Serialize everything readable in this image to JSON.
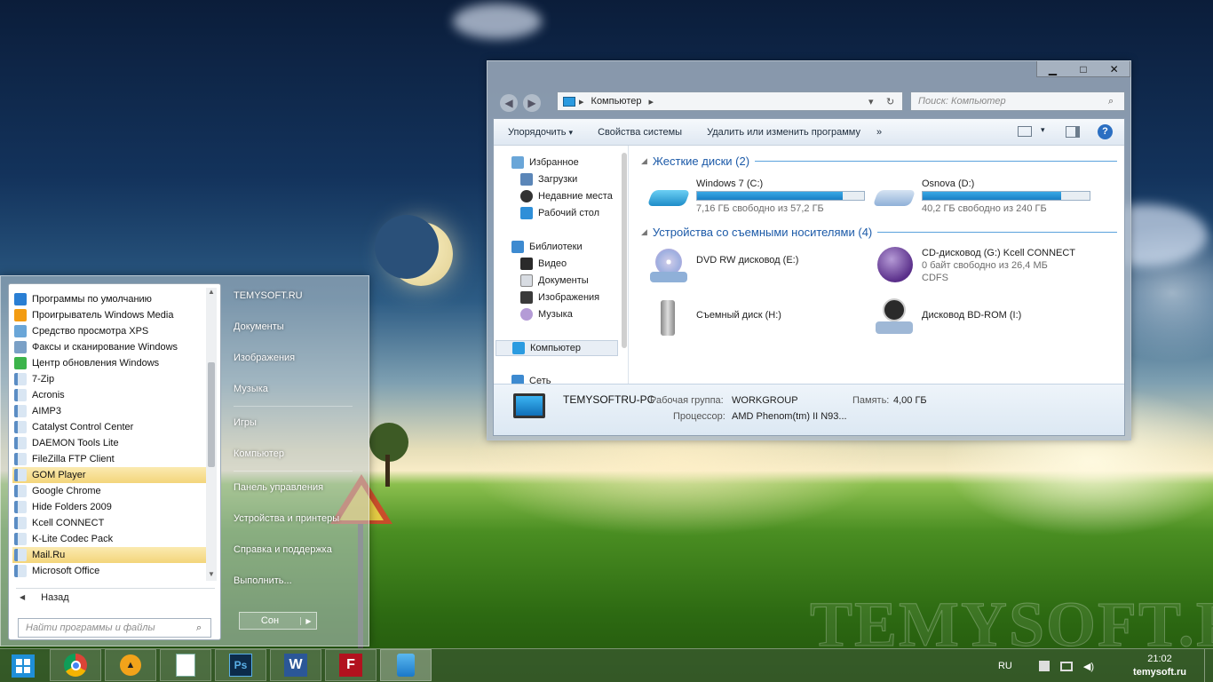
{
  "explorer": {
    "window_controls": {
      "minimize": "▁",
      "maximize": "□",
      "close": "✕"
    },
    "address": {
      "crumb": "Компьютер",
      "separator": "▸"
    },
    "search_placeholder": "Поиск: Компьютер",
    "toolbar": {
      "organize": "Упорядочить",
      "system_properties": "Свойства системы",
      "uninstall": "Удалить или изменить программу",
      "more": "»"
    },
    "nav": {
      "favorites": "Избранное",
      "downloads": "Загрузки",
      "recent": "Недавние места",
      "desktop": "Рабочий стол",
      "libraries": "Библиотеки",
      "video": "Видео",
      "documents": "Документы",
      "images": "Изображения",
      "music": "Музыка",
      "computer": "Компьютер",
      "network": "Сеть"
    },
    "groups": {
      "hard_drives": "Жесткие диски (2)",
      "removable": "Устройства со съемными носителями (4)"
    },
    "drives": [
      {
        "name": "Windows 7 (C:)",
        "free": "7,16 ГБ свободно из 57,2 ГБ",
        "used_fraction": 0.87
      },
      {
        "name": "Osnova (D:)",
        "free": "40,2 ГБ свободно из 240 ГБ",
        "used_fraction": 0.83
      }
    ],
    "removable": [
      {
        "name": "DVD RW дисковод (E:)"
      },
      {
        "name": "CD-дисковод (G:) Kcell CONNECT",
        "line2": "0 байт свободно из 26,4 МБ",
        "line3": "CDFS"
      },
      {
        "name": "Съемный диск (H:)"
      },
      {
        "name": "Дисковод BD-ROM (I:)"
      }
    ],
    "details": {
      "pc_name": "TEMYSOFTRU-PC",
      "workgroup_label": "Рабочая группа:",
      "workgroup": "WORKGROUP",
      "memory_label": "Память:",
      "memory": "4,00 ГБ",
      "cpu_label": "Процессор:",
      "cpu": "AMD Phenom(tm) II N93..."
    }
  },
  "start_menu": {
    "programs": [
      "Программы по умолчанию",
      "Проигрыватель Windows Media",
      "Средство просмотра XPS",
      "Факсы и сканирование Windows",
      "Центр обновления Windows",
      "7-Zip",
      "Acronis",
      "AIMP3",
      "Catalyst Control Center",
      "DAEMON Tools Lite",
      "FileZilla FTP Client",
      "GOM Player",
      "Google Chrome",
      "Hide Folders 2009",
      "Kcell CONNECT",
      "K-Lite Codec Pack",
      "Mail.Ru",
      "Microsoft Office"
    ],
    "back": "Назад",
    "search_placeholder": "Найти программы и файлы",
    "right": [
      "TEMYSOFT.RU",
      "Документы",
      "Изображения",
      "Музыка",
      "Игры",
      "Компьютер",
      "Панель управления",
      "Устройства и принтеры",
      "Справка и поддержка",
      "Выполнить..."
    ],
    "sleep": "Сон"
  },
  "taskbar": {
    "lang": "RU",
    "time": "21:02",
    "site": "temysoft.ru"
  },
  "wallpaper_watermark": "TEMYSOFT.RU",
  "colors": {
    "accent": "#1a7fc4",
    "highlight": "#f3d57a",
    "group_header": "#1c5aa8"
  }
}
